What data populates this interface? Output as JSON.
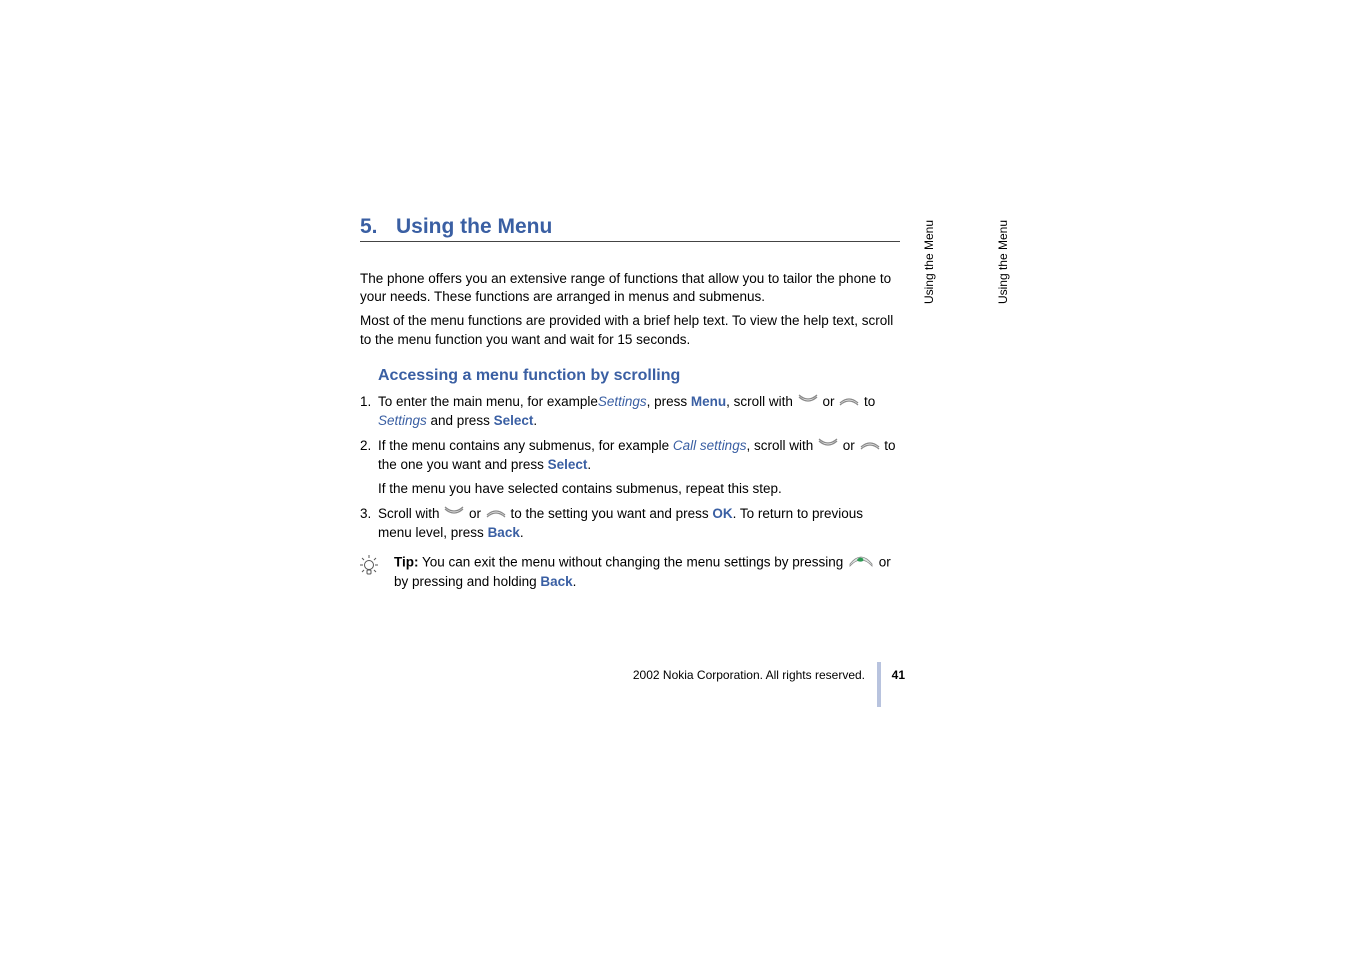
{
  "chapter": {
    "number": "5.",
    "title": "Using the Menu"
  },
  "intro": {
    "p1": "The phone offers you an extensive range of functions that allow you to tailor the phone to your needs. These functions are arranged in menus and submenus.",
    "p2": "Most of the menu functions are provided with a brief help text. To view the help text, scroll to the menu function you want and wait for 15 seconds."
  },
  "section": {
    "title": "Accessing a menu function by scrolling"
  },
  "list": {
    "n1": "1.",
    "i1_a": "To enter the main menu, for example",
    "i1_settings_it": "Settings",
    "i1_b": ", press ",
    "i1_menu": "Menu",
    "i1_c": ", scroll with ",
    "i1_or": " or ",
    "i1_d": " to ",
    "i1_settings_it2": "Settings",
    "i1_e": " and press ",
    "i1_select": "Select",
    "i1_f": ".",
    "n2": "2.",
    "i2_a": "If the menu contains any submenus, for example ",
    "i2_call": "Call settings",
    "i2_b": ", scroll with ",
    "i2_or": " or ",
    "i2_c": " to the one you want and press ",
    "i2_select": "Select",
    "i2_d": ".",
    "i2_sub": "If the menu you have selected contains submenus, repeat this step.",
    "n3": "3.",
    "i3_a": "Scroll with ",
    "i3_or": " or ",
    "i3_b": " to the setting you want and press ",
    "i3_ok": "OK",
    "i3_c": ". To return to previous menu level, press ",
    "i3_back": "Back",
    "i3_d": "."
  },
  "tip": {
    "label": "Tip:",
    "a": " You can exit the menu without changing the menu settings by pressing ",
    "b": " or by pressing and holding ",
    "back": "Back",
    "c": "."
  },
  "sidetab": "Using the Menu",
  "footer": {
    "copyright": "2002 Nokia Corporation. All rights reserved.",
    "page": "41"
  }
}
